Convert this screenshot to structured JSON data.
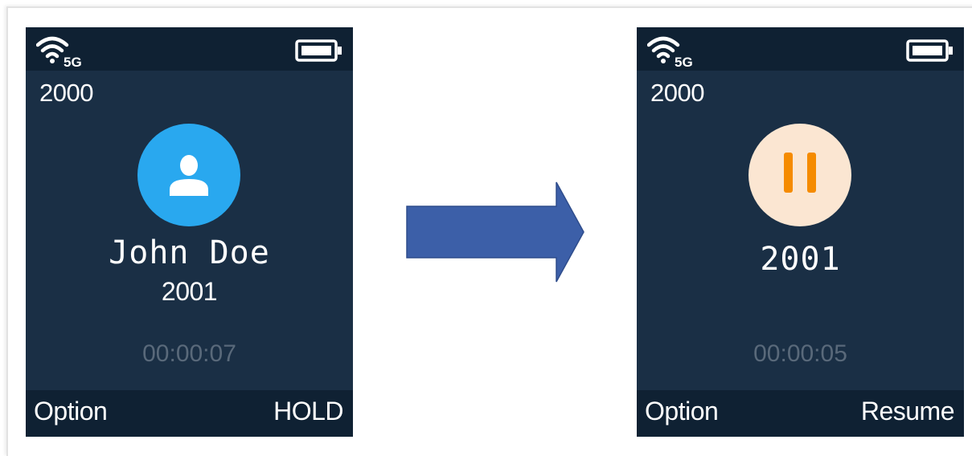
{
  "colors": {
    "screen_bg": "#1a2f45",
    "bar_bg": "#0f2133",
    "avatar_blue": "#29a8ef",
    "hold_circle": "#fbe6d2",
    "hold_orange": "#f58b00",
    "timer_gray": "#59697a",
    "arrow_blue": "#3c5fa8"
  },
  "left_screen": {
    "status": {
      "wifi_icon": "wifi-5g-icon",
      "wifi_label": "5G",
      "battery_icon": "battery-icon"
    },
    "line_number": "2000",
    "avatar_icon": "contact-avatar-icon",
    "contact_name": "John Doe",
    "contact_number": "2001",
    "call_timer": "00:00:07",
    "softkeys": {
      "left": "Option",
      "right": "HOLD"
    }
  },
  "arrow_icon": "right-arrow-icon",
  "right_screen": {
    "status": {
      "wifi_icon": "wifi-5g-icon",
      "wifi_label": "5G",
      "battery_icon": "battery-icon"
    },
    "line_number": "2000",
    "hold_icon": "pause-icon",
    "contact_number": "2001",
    "call_timer": "00:00:05",
    "softkeys": {
      "left": "Option",
      "right": "Resume"
    }
  }
}
